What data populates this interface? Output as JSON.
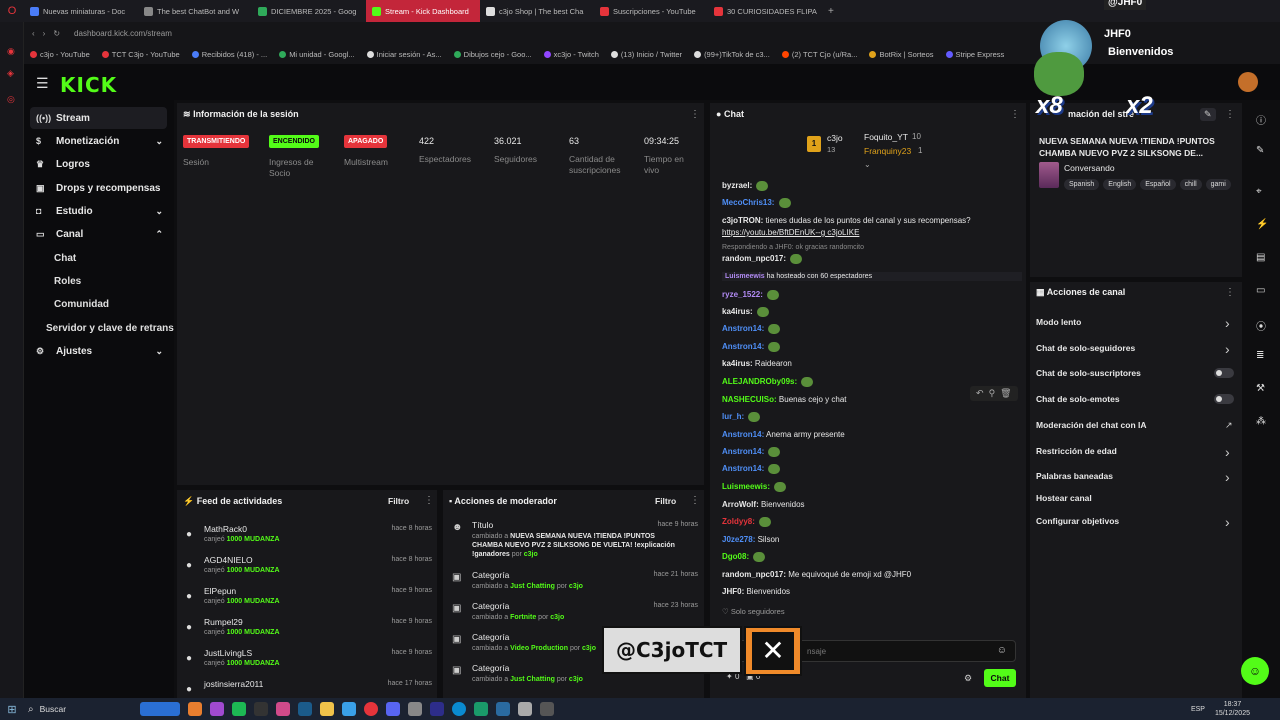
{
  "browser": {
    "tabs": [
      "Nuevas miniaturas - Doc",
      "The best ChatBot and W",
      "DICIEMBRE 2025 - Goog",
      "Stream - Kick Dashboard",
      "c3jo Shop | The best Cha",
      "Suscripciones - YouTube",
      "30 CURIOSIDADES FLIPA"
    ],
    "active_tab": 3,
    "new_tab": "+",
    "url": "dashboard.kick.com/stream",
    "bookmarks": [
      "c3jo - YouTube",
      "TCT C3jo - YouTube",
      "Recibidos (418) - ...",
      "Mi unidad - Googl...",
      "Iniciar sesión - As...",
      "Dibujos cejo - Goo...",
      "xc3jo - Twitch",
      "(13) Inicio / Twitter",
      "(99+)TikTok de c3...",
      "(2) TCT Cjo (u/Ra...",
      "BotRix | Sorteos",
      "Stripe Express"
    ]
  },
  "kick": {
    "logo": "KICK",
    "menu_icon": "hamburger-icon"
  },
  "sidebar": {
    "items": [
      {
        "label": "Stream",
        "icon": "radio-icon"
      },
      {
        "label": "Monetización",
        "icon": "dollar-icon"
      },
      {
        "label": "Logros",
        "icon": "trophy-icon"
      },
      {
        "label": "Drops y recompensas",
        "icon": "gift-icon"
      },
      {
        "label": "Estudio",
        "icon": "studio-icon"
      },
      {
        "label": "Canal",
        "icon": "channel-icon"
      },
      {
        "label": "Ajustes",
        "icon": "gear-icon"
      }
    ],
    "canal_sub": [
      "Chat",
      "Roles",
      "Comunidad"
    ],
    "server": "Servidor y clave de retrans"
  },
  "session": {
    "title": "Información de la sesión",
    "badges": [
      {
        "text": "TRANSMITIENDO",
        "label": "Sesión",
        "color": "#e5343b"
      },
      {
        "text": "ENCENDIDO",
        "label": "Ingresos de Socio",
        "color": "#53fc18"
      },
      {
        "text": "APAGADO",
        "label": "Multistream",
        "color": "#e5343b"
      }
    ],
    "stats": [
      {
        "value": "422",
        "label": "Espectadores"
      },
      {
        "value": "36.021",
        "label": "Seguidores"
      },
      {
        "value": "63",
        "label": "Cantidad de suscripciones"
      },
      {
        "value": "09:34:25",
        "label": "Tiempo en vivo"
      }
    ]
  },
  "activity": {
    "title": "Feed de actividades",
    "filter": "Filtro",
    "rows": [
      {
        "name": "MathRack0",
        "desc": "canjeó",
        "reward": "1000 MUDANZA",
        "time": "hace 8 horas"
      },
      {
        "name": "AGD4NIELO",
        "desc": "canjeó",
        "reward": "1000 MUDANZA",
        "time": "hace 8 horas"
      },
      {
        "name": "ElPepun",
        "desc": "canjeó",
        "reward": "1000 MUDANZA",
        "time": "hace 9 horas"
      },
      {
        "name": "Rumpel29",
        "desc": "canjeó",
        "reward": "1000 MUDANZA",
        "time": "hace 9 horas"
      },
      {
        "name": "JustLivingLS",
        "desc": "canjeó",
        "reward": "1000 MUDANZA",
        "time": "hace 9 horas"
      },
      {
        "name": "jostinsierra2011",
        "desc": "",
        "reward": "",
        "time": "hace 17 horas"
      }
    ]
  },
  "mod": {
    "title": "Acciones de moderador",
    "filter": "Filtro",
    "rows": [
      {
        "head": "Título",
        "pre": "cambiado a",
        "value": "NUEVA SEMANA NUEVA !TIENDA !PUNTOS CHAMBA NUEVO PVZ 2 SILKSONG DE VUELTA! !explicación !ganadores",
        "by": "por",
        "user": "c3jo",
        "time": "hace 9 horas"
      },
      {
        "head": "Categoría",
        "pre": "cambiado a",
        "value": "Just Chatting",
        "by": "por",
        "user": "c3jo",
        "time": "hace 21 horas"
      },
      {
        "head": "Categoría",
        "pre": "cambiado a",
        "value": "Fortnite",
        "by": "por",
        "user": "c3jo",
        "time": "hace 23 horas"
      },
      {
        "head": "Categoría",
        "pre": "cambiado a",
        "value": "Video Production",
        "by": "por",
        "user": "c3jo",
        "time": ""
      },
      {
        "head": "Categoría",
        "pre": "cambiado a",
        "value": "Just Chatting",
        "by": "por",
        "user": "c3jo",
        "time": ""
      }
    ]
  },
  "chat": {
    "title": "Chat",
    "top": [
      {
        "rank": "1",
        "name": "c3jo",
        "count": "13"
      },
      {
        "name": "Foquito_YT",
        "count": "10"
      },
      {
        "name": "Franquiny23",
        "count": "1"
      }
    ],
    "messages": [
      {
        "user": "byzrael:",
        "text": "",
        "color": "#e8e8e8"
      },
      {
        "user": "MecoChris13:",
        "text": "",
        "color": "#4f8ff7"
      },
      {
        "user": "c3joTRON:",
        "text": "tienes dudas de los puntos del canal y sus recompensas?",
        "color": "#e8e8e8"
      },
      {
        "user": "",
        "text": "https://youtu.be/BftDEnUK--g c3joLIKE",
        "color": "#e8e8e8"
      },
      {
        "user": "",
        "text": "Respondiendo a JHF0: ok gracias randomcito",
        "color": "#8a8a8a"
      },
      {
        "user": "random_npc017:",
        "text": "",
        "color": "#e8e8e8"
      },
      {
        "user": "Luismeewis",
        "text": "ha hosteado con 60 espectadores",
        "color": "#b18af3"
      },
      {
        "user": "ryze_1522:",
        "text": "",
        "color": "#b18af3"
      },
      {
        "user": "ka4irus:",
        "text": "",
        "color": "#e8e8e8"
      },
      {
        "user": "Anstron14:",
        "text": "",
        "color": "#4f8ff7"
      },
      {
        "user": "Anstron14:",
        "text": "",
        "color": "#4f8ff7"
      },
      {
        "user": "ka4irus:",
        "text": "Raidearon",
        "color": "#e8e8e8"
      },
      {
        "user": "ALEJANDROby09s:",
        "text": "",
        "color": "#53fc18"
      },
      {
        "user": "NASHECUISo:",
        "text": "Buenas cejo y chat",
        "color": "#53fc18"
      },
      {
        "user": "lur_h:",
        "text": "",
        "color": "#4f8ff7"
      },
      {
        "user": "Anstron14:",
        "text": "Anema army presente",
        "color": "#4f8ff7"
      },
      {
        "user": "Anstron14:",
        "text": "",
        "color": "#4f8ff7"
      },
      {
        "user": "Anstron14:",
        "text": "",
        "color": "#4f8ff7"
      },
      {
        "user": "Luismeewis:",
        "text": "",
        "color": "#53fc18"
      },
      {
        "user": "ArroWolf:",
        "text": "Bienvenidos",
        "color": "#e8e8e8"
      },
      {
        "user": "Zoldyy8:",
        "text": "",
        "color": "#e5343b"
      },
      {
        "user": "J0ze278:",
        "text": "Silson",
        "color": "#4f8ff7"
      },
      {
        "user": "Dgo08:",
        "text": "",
        "color": "#53fc18"
      },
      {
        "user": "random_npc017:",
        "text": "Me equivoqué de emoji xd @JHF0",
        "color": "#e8e8e8"
      },
      {
        "user": "JHF0:",
        "text": "Bienvenidos",
        "color": "#e8e8e8"
      }
    ],
    "followers_only": "Solo seguidores",
    "input_placeholder": "nsaje",
    "send": "Chat",
    "bottom_counts": [
      "0",
      "0"
    ]
  },
  "stream_info": {
    "title": "mación del stre",
    "stream_title": "NUEVA SEMANA NUEVA !TIENDA !PUNTOS CHAMBA NUEVO PVZ 2 SILKSONG DE...",
    "category": "Conversando",
    "tags": [
      "Spanish",
      "English",
      "Español",
      "chill",
      "gami"
    ]
  },
  "channel_actions": {
    "title": "Acciones de canal",
    "items": [
      {
        "label": "Modo lento",
        "ctrl": "chevron"
      },
      {
        "label": "Chat de solo-seguidores",
        "ctrl": "chevron"
      },
      {
        "label": "Chat de solo-suscriptores",
        "ctrl": "toggle"
      },
      {
        "label": "Chat de solo-emotes",
        "ctrl": "toggle"
      },
      {
        "label": "Moderación del chat con IA",
        "ctrl": "external"
      },
      {
        "label": "Restricción de edad",
        "ctrl": "chevron"
      },
      {
        "label": "Palabras baneadas",
        "ctrl": "chevron"
      },
      {
        "label": "Hostear canal",
        "ctrl": "none"
      },
      {
        "label": "Configurar objetivos",
        "ctrl": "chevron"
      }
    ]
  },
  "overlay": {
    "handle": "@C3joTCT",
    "notif_user": "JHF0",
    "notif_top": "@JHF0",
    "notif_text": "Bienvenidos",
    "mult_a": "x8",
    "mult_b": "x2"
  },
  "taskbar": {
    "search": "Buscar",
    "lang": "ESP",
    "time": "18:37",
    "date": "15/12/2025"
  },
  "colors": {
    "kick_green": "#53fc18",
    "panel": "#18181b",
    "bg": "#0e0e10",
    "red": "#e5343b"
  }
}
